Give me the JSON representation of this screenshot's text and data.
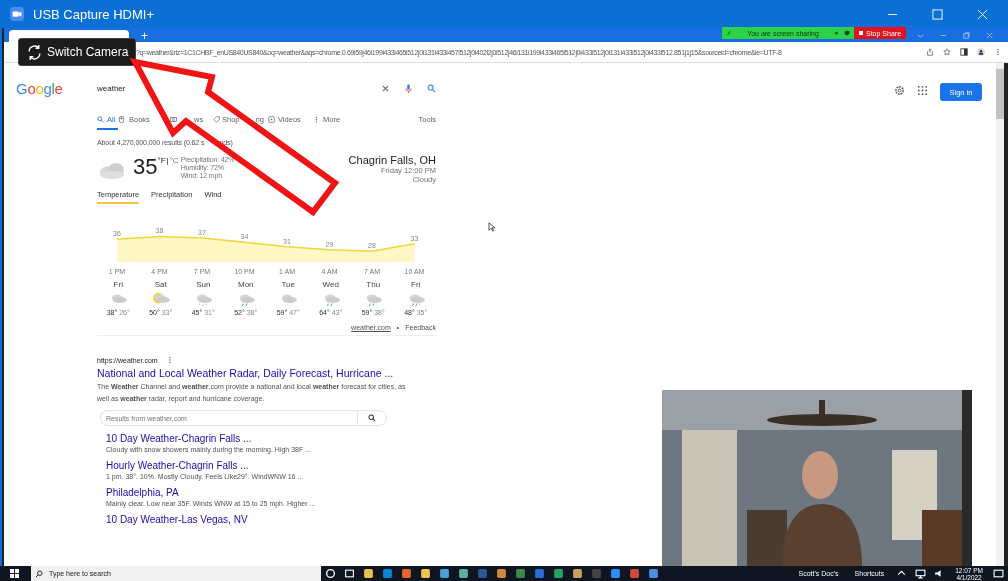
{
  "window": {
    "title": "USB Capture HDMI+"
  },
  "camera_tooltip": {
    "label": "Switch Camera"
  },
  "share_bar": {
    "status": "You are screen sharing",
    "stop": "Stop Share"
  },
  "browser": {
    "new_tab": "+",
    "url": "?q=weather&rlz=1C1CHBF_enUS840US840&oq=weather&aqs=chrome.0.69i59j46i199i433i465i512j0i131i433i457i512j0i402l2j0i512j46i131i199i433i465i512j0i433i512j0i131i433i512j0i433i512.851j1j15&sourceid=chrome&ie=UTF-8"
  },
  "google": {
    "logo": "Google",
    "query": "weather",
    "sign_in": "Sign in",
    "tabs": [
      {
        "label": "All",
        "selected": true
      },
      {
        "label": "Books",
        "selected": false
      },
      {
        "label": "ws",
        "selected": false
      },
      {
        "label": "Shop",
        "tail": "ng",
        "selected": false
      },
      {
        "label": "Videos",
        "selected": false
      },
      {
        "label": "More",
        "selected": false
      }
    ],
    "tools": "Tools",
    "result_count": "About 4,270,000,000 results (0.62 s",
    "result_count_tail": "nds)"
  },
  "weather": {
    "temp": "35",
    "unit_f": "°F",
    "separator": "|",
    "unit_c": "°C",
    "precipitation": "Precipitation: 42%",
    "humidity": "Humidity: 72%",
    "wind": "Wind: 12 mph",
    "location": "Chagrin Falls, OH",
    "time": "Friday 12:00 PM",
    "condition": "Cloudy",
    "subtabs": [
      {
        "label": "Temperature",
        "selected": true
      },
      {
        "label": "Precipitation",
        "selected": false
      },
      {
        "label": "Wind",
        "selected": false
      }
    ],
    "chart_data": {
      "type": "area",
      "categories": [
        "1 PM",
        "4 PM",
        "7 PM",
        "10 PM",
        "1 AM",
        "4 AM",
        "7 AM",
        "10 AM"
      ],
      "values": [
        36,
        38,
        37,
        34,
        31,
        29,
        28,
        33
      ],
      "data_labels": true
    },
    "days": [
      {
        "day": "Fri",
        "kind": "cloudy",
        "high": "38°",
        "low": "26°"
      },
      {
        "day": "Sat",
        "kind": "partly-sunny",
        "high": "50°",
        "low": "33°"
      },
      {
        "day": "Sun",
        "kind": "snow",
        "high": "45°",
        "low": "31°"
      },
      {
        "day": "Mon",
        "kind": "rain",
        "high": "52°",
        "low": "38°"
      },
      {
        "day": "Tue",
        "kind": "cloudy",
        "high": "59°",
        "low": "47°"
      },
      {
        "day": "Wed",
        "kind": "rain",
        "high": "64°",
        "low": "43°"
      },
      {
        "day": "Thu",
        "kind": "rain",
        "high": "59°",
        "low": "38°"
      },
      {
        "day": "Fri",
        "kind": "mixed",
        "high": "48°",
        "low": "35°"
      }
    ],
    "source": "weather.com",
    "dot": "•",
    "feedback": "Feedback"
  },
  "result": {
    "url": "https://weather.com",
    "title": "National and Local Weather Radar, Daily Forecast, Hurricane ...",
    "snippet": "The **Weather** Channel and **weather**.com provide a national and local **weather** forecast for cities, as well as **weather** radar, report and hurricane coverage.",
    "site_search_placeholder": "Results from weather.com",
    "sublinks": [
      {
        "title": "10 Day Weather-Chagrin Falls ...",
        "text": "Cloudy with snow showers mainly during the morning. High 38F ..."
      },
      {
        "title": "Hourly Weather-Chagrin Falls ...",
        "text": "1 pm. 38°. 10%. Mostly Cloudy. Feels Like29°. WindWNW 16 ..."
      },
      {
        "title": "Philadelphia, PA",
        "text": "Mainly clear. Low near 35F. Winds WNW at 15 to 25 mph. Higher ..."
      },
      {
        "title": "10 Day Weather-Las Vegas, NV"
      }
    ]
  },
  "taskbar": {
    "search": "Type here to search",
    "toolbars": [
      "Scott's Doc's",
      "Shortcuts"
    ],
    "time": "12:07 PM",
    "date": "4/1/2022"
  }
}
